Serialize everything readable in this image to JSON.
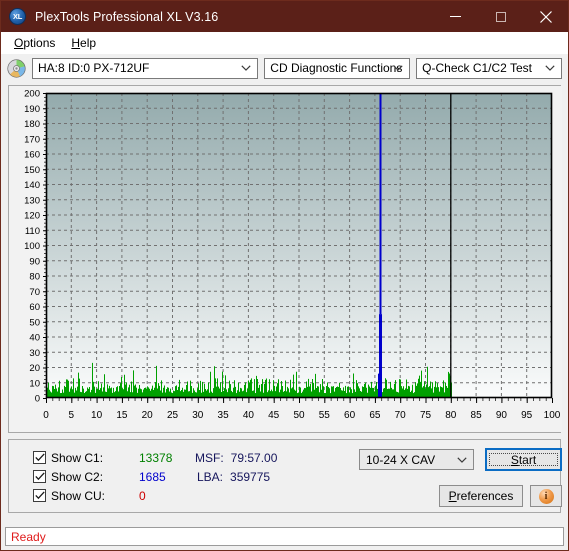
{
  "window": {
    "title": "PlexTools Professional XL V3.16",
    "app_icon_text": "XL",
    "titlebar_color": "#5b2018",
    "minimize_label": "Minimize",
    "maximize_label": "Maximize",
    "close_label": "Close"
  },
  "menu": {
    "items": [
      {
        "label": "Options",
        "accel": "O"
      },
      {
        "label": "Help",
        "accel": "H"
      }
    ]
  },
  "toolbar": {
    "drive_combo": {
      "value": "HA:8 ID:0  PX-712UF"
    },
    "function_combo": {
      "value": "CD Diagnostic Functions"
    },
    "test_combo": {
      "value": "Q-Check C1/C2 Test"
    }
  },
  "controls": {
    "checkboxes": [
      {
        "label": "Show C1:",
        "value": "13378",
        "color": "#008000",
        "checked": true
      },
      {
        "label": "Show C2:",
        "value": "1685",
        "color": "#0000cc",
        "checked": true
      },
      {
        "label": "Show CU:",
        "value": "0",
        "color": "#cc0000",
        "checked": true
      }
    ],
    "stats": [
      {
        "label": "MSF:",
        "value": "79:57.00"
      },
      {
        "label": "LBA:",
        "value": "359775"
      }
    ],
    "speed_combo": {
      "value": "10-24 X CAV"
    },
    "start_button": "Start",
    "start_accel": "S",
    "preferences_button": "Preferences",
    "preferences_accel": "P",
    "info_button_glyph": "i"
  },
  "statusbar": {
    "text": "Ready"
  },
  "chart_data": {
    "type": "line",
    "title": "",
    "xlabel": "",
    "ylabel": "",
    "xlim": [
      0,
      100
    ],
    "ylim": [
      0,
      200
    ],
    "xticks": [
      0,
      5,
      10,
      15,
      20,
      25,
      30,
      35,
      40,
      45,
      50,
      55,
      60,
      65,
      70,
      75,
      80,
      85,
      90,
      95,
      100
    ],
    "yticks": [
      0,
      10,
      20,
      30,
      40,
      50,
      60,
      70,
      80,
      90,
      100,
      110,
      120,
      130,
      140,
      150,
      160,
      170,
      180,
      190,
      200
    ],
    "grid": true,
    "legend_position": "none",
    "plot_bg_top": "#93aaac",
    "plot_bg_bottom": "#fbfcfc",
    "data_end_x": 80,
    "series": [
      {
        "name": "C1",
        "color": "#00a000",
        "total": 13378,
        "avg": 9,
        "max": 24,
        "description": "Dense C1 error noise from 0 to 80 minutes, values mostly 3-20, occasional peaks to 24"
      },
      {
        "name": "C2",
        "color": "#0000cc",
        "total": 1685,
        "max": 200,
        "spike_x": 66,
        "spike_y": 200,
        "description": "Single tall C2 spike at ~66 min reaching 200, small cluster near 66 around 55"
      },
      {
        "name": "CU",
        "color": "#cc0000",
        "total": 0,
        "description": "No CU (uncorrectable) errors recorded"
      }
    ]
  }
}
